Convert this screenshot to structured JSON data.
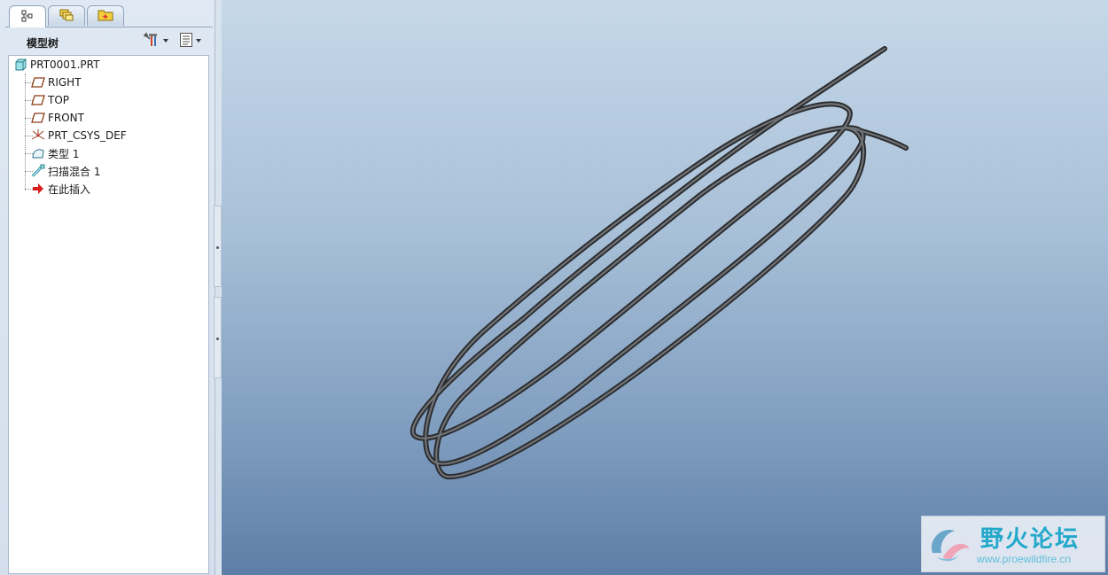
{
  "panel": {
    "tabs": [
      {
        "icon": "model-tree-icon",
        "active": true
      },
      {
        "icon": "layers-icon",
        "active": false
      },
      {
        "icon": "folder-icon",
        "active": false
      }
    ],
    "title": "模型树",
    "settings_icon": "tools-icon",
    "show_icon": "list-icon"
  },
  "tree": {
    "root": "PRT0001.PRT",
    "items": [
      {
        "label": "RIGHT",
        "icon": "datum-plane-icon"
      },
      {
        "label": "TOP",
        "icon": "datum-plane-icon"
      },
      {
        "label": "FRONT",
        "icon": "datum-plane-icon"
      },
      {
        "label": "PRT_CSYS_DEF",
        "icon": "csys-icon"
      },
      {
        "label": "类型 1",
        "icon": "sketch-curve-icon"
      },
      {
        "label": "扫描混合 1",
        "icon": "swept-blend-icon"
      },
      {
        "label": "在此插入",
        "icon": "insert-here-arrow-icon"
      }
    ]
  },
  "watermark": {
    "title": "野火论坛",
    "url": "www.proewildfire.cn"
  },
  "colors": {
    "viewport_top": "#c6d8e9",
    "viewport_bottom": "#5e7ea7",
    "tube": "#3c3d3f",
    "watermark_text": "#23a8ca"
  }
}
